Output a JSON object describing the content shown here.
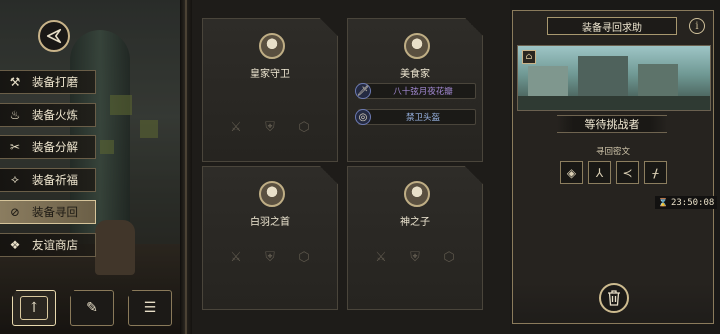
{
  "sidebar": {
    "items": [
      {
        "label": "装备打磨",
        "icon": "hammer-icon",
        "active": false
      },
      {
        "label": "装备火炼",
        "icon": "flame-icon",
        "active": false
      },
      {
        "label": "装备分解",
        "icon": "split-icon",
        "active": false
      },
      {
        "label": "装备祈福",
        "icon": "bless-icon",
        "active": false
      },
      {
        "label": "装备寻回",
        "icon": "retrieve-icon",
        "active": true
      },
      {
        "label": "友谊商店",
        "icon": "shop-icon",
        "active": false
      }
    ]
  },
  "bottom_tabs": [
    {
      "icon": "upload-icon",
      "active": true
    },
    {
      "icon": "feather-icon",
      "active": false
    },
    {
      "icon": "list-icon",
      "active": false
    }
  ],
  "cards": [
    {
      "name": "皇家守卫",
      "equips": []
    },
    {
      "name": "美食家",
      "equips": [
        {
          "label": "八十弦月夜花瓣",
          "color": "#a58bd6",
          "icon": "dagger-icon"
        },
        {
          "label": "禁卫头盔",
          "color": "#9bb6e6",
          "icon": "ring-icon"
        }
      ]
    },
    {
      "name": "白羽之首",
      "equips": []
    },
    {
      "name": "神之子",
      "equips": []
    }
  ],
  "panel": {
    "title": "装备寻回求助",
    "status": "等待挑战者",
    "rune_title": "寻回密文",
    "timer": "23:50:08",
    "info_icon": "i"
  }
}
